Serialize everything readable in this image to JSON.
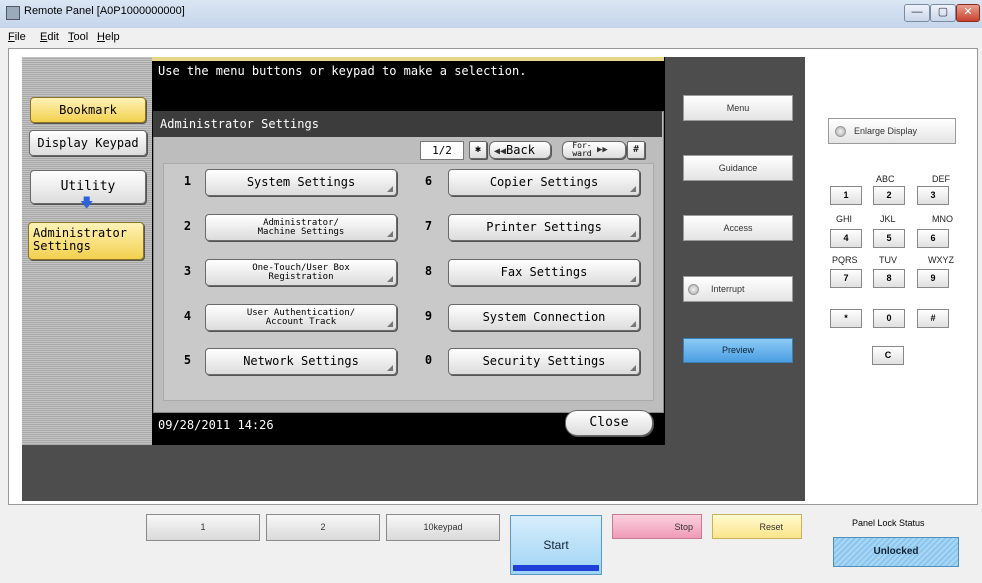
{
  "window": {
    "title": "Remote Panel [A0P1000000000]",
    "minimize": "—",
    "maximize": "▢",
    "close": "✕"
  },
  "menubar": {
    "items": [
      {
        "key": "F",
        "rest": "ile"
      },
      {
        "key": "E",
        "rest": "dit"
      },
      {
        "key": "T",
        "rest": "ool"
      },
      {
        "key": "H",
        "rest": "elp"
      }
    ]
  },
  "lcd": {
    "instruction": "Use the menu buttons or keypad to make a selection.",
    "datetime": "09/28/2011   14:26"
  },
  "sidebar": {
    "bookmark": "Bookmark",
    "display_keypad": "Display Keypad",
    "utility": "Utility",
    "administrator_settings": "Administrator Settings"
  },
  "dialog": {
    "title": "Administrator Settings",
    "page": "1/2",
    "star": "✱",
    "back": "Back",
    "forward": "For- ward",
    "hash": "#",
    "close": "Close",
    "items": [
      {
        "num": "1",
        "label": "System Settings"
      },
      {
        "num": "2",
        "label": "Administrator/ Machine Settings"
      },
      {
        "num": "3",
        "label": "One-Touch/User Box Registration"
      },
      {
        "num": "4",
        "label": "User Authentication/ Account Track"
      },
      {
        "num": "5",
        "label": "Network Settings"
      },
      {
        "num": "6",
        "label": "Copier Settings"
      },
      {
        "num": "7",
        "label": "Printer Settings"
      },
      {
        "num": "8",
        "label": "Fax Settings"
      },
      {
        "num": "9",
        "label": "System Connection"
      },
      {
        "num": "0",
        "label": "Security Settings"
      }
    ]
  },
  "side_buttons": {
    "menu": "Menu",
    "guidance": "Guidance",
    "access": "Access",
    "interrupt": "Interrupt",
    "preview": "Preview"
  },
  "keypad": {
    "enlarge_display": "Enlarge Display",
    "letters": [
      "ABC",
      "DEF",
      "GHI",
      "JKL",
      "MNO",
      "PQRS",
      "TUV",
      "WXYZ"
    ],
    "keys": [
      "1",
      "2",
      "3",
      "4",
      "5",
      "6",
      "7",
      "8",
      "9",
      "*",
      "0",
      "#",
      "C"
    ]
  },
  "bottom": {
    "btn1": "1",
    "btn2": "2",
    "tenkeypad": "10keypad",
    "start": "Start",
    "stop": "Stop",
    "reset": "Reset",
    "panel_lock_label": "Panel Lock Status",
    "panel_lock_value": "Unlocked"
  },
  "colors": {
    "accent_yellow": "#f2d04e",
    "preview_blue": "#6ab4ec",
    "stop_pink": "#f4b2c6",
    "reset_yellow": "#fdf1a6",
    "start_bar_blue": "#1f3fd8"
  }
}
